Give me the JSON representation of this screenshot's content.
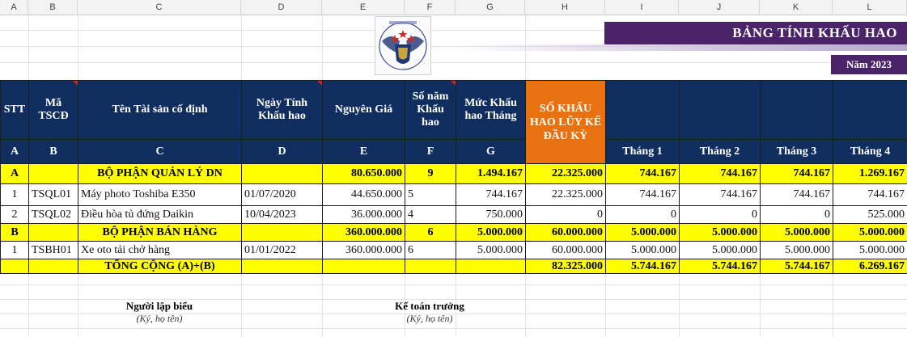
{
  "columns": [
    "A",
    "B",
    "C",
    "D",
    "E",
    "F",
    "G",
    "H",
    "I",
    "J",
    "K",
    "L"
  ],
  "title": "BẢNG TÍNH KHẤU HAO",
  "year": "Năm 2023",
  "header": {
    "stt": "STT",
    "ma": "Mã TSCĐ",
    "ten": "Tên Tài sản cố định",
    "ngay": "Ngày Tính Khấu hao",
    "nguyen": "Nguyên Giá",
    "sonam": "Số năm Khấu hao",
    "muc": "Mức Khấu hao Tháng",
    "so_kh": "SỐ KHẤU HAO LŨY KẾ ĐẦU KỲ",
    "letters": [
      "A",
      "B",
      "C",
      "D",
      "E",
      "F",
      "G"
    ],
    "months": [
      "Tháng 1",
      "Tháng 2",
      "Tháng 3",
      "Tháng 4"
    ]
  },
  "section_a": {
    "code": "A",
    "name": "BỘ PHẬN QUẢN LÝ DN",
    "nguyen": "80.650.000",
    "sonam": "9",
    "muc": "1.494.167",
    "luyke": "22.325.000",
    "months": [
      "744.167",
      "744.167",
      "744.167",
      "1.269.167"
    ]
  },
  "rows_a": [
    {
      "stt": "1",
      "ma": "TSQL01",
      "ten": "Máy photo Toshiba E350",
      "ngay": "01/07/2020",
      "nguyen": "44.650.000",
      "sonam": "5",
      "muc": "744.167",
      "luyke": "22.325.000",
      "months": [
        "744.167",
        "744.167",
        "744.167",
        "744.167"
      ]
    },
    {
      "stt": "2",
      "ma": "TSQL02",
      "ten": "Điều hòa tủ đứng Daikin",
      "ngay": "10/04/2023",
      "nguyen": "36.000.000",
      "sonam": "4",
      "muc": "750.000",
      "luyke": "0",
      "months": [
        "0",
        "0",
        "0",
        "525.000"
      ]
    }
  ],
  "section_b": {
    "code": "B",
    "name": "BỘ PHẬN BÁN HÀNG",
    "nguyen": "360.000.000",
    "sonam": "6",
    "muc": "5.000.000",
    "luyke": "60.000.000",
    "months": [
      "5.000.000",
      "5.000.000",
      "5.000.000",
      "5.000.000"
    ]
  },
  "rows_b": [
    {
      "stt": "1",
      "ma": "TSBH01",
      "ten": "Xe oto tải chở hàng",
      "ngay": "01/01/2022",
      "nguyen": "360.000.000",
      "sonam": "6",
      "muc": "5.000.000",
      "luyke": "60.000.000",
      "months": [
        "5.000.000",
        "5.000.000",
        "5.000.000",
        "5.000.000"
      ]
    }
  ],
  "total": {
    "label": "TỔNG CỘNG (A)+(B)",
    "luyke": "82.325.000",
    "months": [
      "5.744.167",
      "5.744.167",
      "5.744.167",
      "6.269.167"
    ]
  },
  "signatures": {
    "preparer_title": "Người lập biểu",
    "preparer_sub": "(Ký, họ tên)",
    "accountant_title": "Kế toán trưởng",
    "accountant_sub": "(Ký, họ tên)"
  },
  "colors": {
    "header_bg": "#0f2d5e",
    "accent_orange": "#e8720f",
    "section_yellow": "#ffff00",
    "banner_purple": "#4a2368"
  },
  "icons": [
    "company-logo-icon"
  ]
}
